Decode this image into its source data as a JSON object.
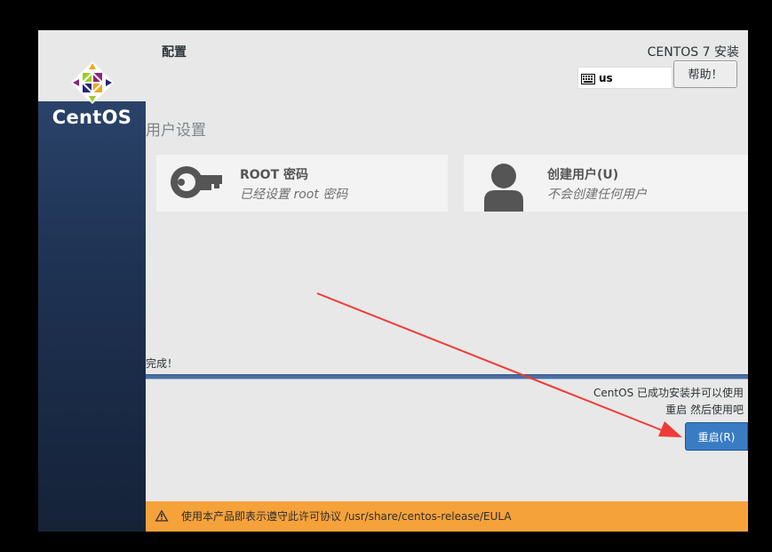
{
  "brand": {
    "name": "CentOS"
  },
  "header": {
    "title": "配置",
    "product": "CENTOS 7 安装",
    "keyboard_layout": "us",
    "help_label": "帮助！"
  },
  "section": {
    "title": "用户设置"
  },
  "spokes": [
    {
      "title": "ROOT 密码",
      "status": "已经设置 root 密码",
      "icon": "key-icon"
    },
    {
      "title": "创建用户(U)",
      "status": "不会创建任何用户",
      "icon": "user-icon"
    }
  ],
  "progress": {
    "label": "完成！",
    "value": 1.0
  },
  "completion": {
    "line1": "CentOS 已成功安装并可以使用",
    "line2": "重启 然后使用吧",
    "reboot_label": "重启(R)"
  },
  "eula": {
    "text": "使用本产品即表示遵守此许可协议 /usr/share/centos-release/EULA",
    "icon": "warning-icon"
  },
  "colors": {
    "sidebar": "#1f3354",
    "accent": "#3a7cc4",
    "warning_bar": "#f5a23b",
    "annotation_arrow": "#ef3b36"
  }
}
